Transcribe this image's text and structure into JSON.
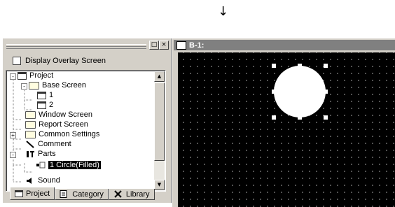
{
  "arrow": "↓",
  "panel": {
    "title_buttons": [
      "□",
      "×"
    ],
    "overlay_label": "Display Overlay Screen",
    "tree": [
      {
        "label": "Project",
        "icon": "project-icon"
      },
      {
        "label": "Base Screen",
        "icon": "folder-icon"
      },
      {
        "label": "1",
        "icon": "screen-icon"
      },
      {
        "label": "2",
        "icon": "screen-icon"
      },
      {
        "label": "Window Screen",
        "icon": "folder-icon"
      },
      {
        "label": "Report Screen",
        "icon": "folder-icon"
      },
      {
        "label": "Common Settings",
        "icon": "folder-icon"
      },
      {
        "label": "Comment",
        "icon": "pen-icon"
      },
      {
        "label": "Parts",
        "icon": "parts-icon"
      },
      {
        "label": "1 Circle(Filled)",
        "icon": "part-item-icon"
      },
      {
        "label": "Sound",
        "icon": "sound-icon"
      }
    ],
    "tabs": [
      {
        "label": "Project",
        "icon": "project-tab-icon"
      },
      {
        "label": "Category",
        "icon": "category-icon"
      },
      {
        "label": "Library",
        "icon": "library-icon"
      }
    ]
  },
  "editor": {
    "title": "B-1:"
  }
}
